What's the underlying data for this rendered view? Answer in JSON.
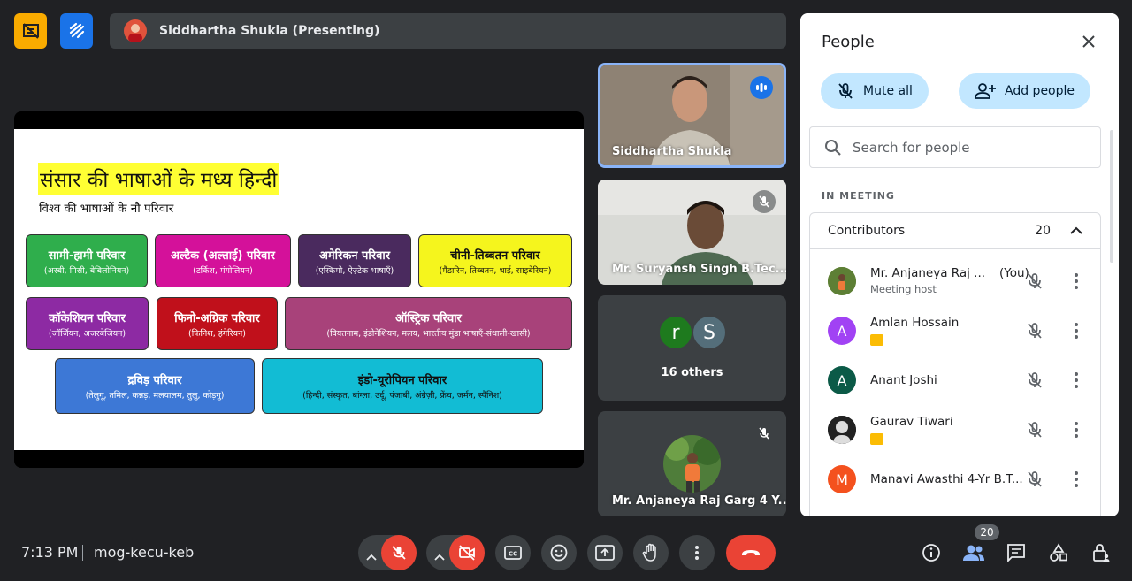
{
  "header": {
    "presenter_label": "Siddhartha Shukla (Presenting)"
  },
  "slide": {
    "title": "संसार की भाषाओं के मध्य हिन्दी",
    "subtitle": "विश्व की भाषाओं के नौ परिवार",
    "families": [
      {
        "name": "सामी-हामी परिवार",
        "desc": "(अरबी, मिस्री, बेबिलोनियन)",
        "bg": "#2fae4c",
        "fg": "#ffffff"
      },
      {
        "name": "अल्टैक (अल्ताई) परिवार",
        "desc": "(टर्किश, मंगोलियन)",
        "bg": "#d4119a",
        "fg": "#ffffff"
      },
      {
        "name": "अमेरिकन परिवार",
        "desc": "(एस्किमो, ऐज़्टेक भाषाएँ)",
        "bg": "#4a2a5e",
        "fg": "#ffffff"
      },
      {
        "name": "चीनी-तिब्बतन परिवार",
        "desc": "(मैंडारिन, तिब्बतन, थाई, साइबेरियन)",
        "bg": "#f5f51d",
        "fg": "#111111"
      },
      {
        "name": "कॉकेशियन परिवार",
        "desc": "(जॉर्जियन, अजरबेजियन)",
        "bg": "#8d2aa3",
        "fg": "#ffffff"
      },
      {
        "name": "फिनो-अग्रिक परिवार",
        "desc": "(फिनिश, हंगेरियन)",
        "bg": "#c0101b",
        "fg": "#ffffff"
      },
      {
        "name": "ऑस्ट्रिक परिवार",
        "desc": "(वियतनाम, इंडोनेशियन, मलय, भारतीय मुंडा भाषाएँ-संथाली-खासी)",
        "bg": "#a8427a",
        "fg": "#ffffff"
      },
      {
        "name": "द्रविड़ परिवार",
        "desc": "(तेलुगू, तमिल, कन्नड़, मलयालम, तुलु, कोड़गु)",
        "bg": "#3d78d6",
        "fg": "#ffffff"
      },
      {
        "name": "इंडो-यूरोपियन परिवार",
        "desc": "(हिन्दी, संस्कृत, बांग्ला, उर्दू, पंजाबी, अंग्रेज़ी, फ्रेंच, जर्मन, स्पैनिश)",
        "bg": "#12bcd4",
        "fg": "#111111"
      }
    ]
  },
  "tiles": {
    "speaker_name": "Siddhartha Shukla",
    "tile2_name": "Mr. Suryansh Singh B.Tec...",
    "others_initials": [
      "r",
      "S"
    ],
    "others_label": "16 others",
    "tile4_name": "Mr. Anjaneya Raj Garg 4 Y..."
  },
  "people_panel": {
    "title": "People",
    "mute_all": "Mute all",
    "add_people": "Add people",
    "search_placeholder": "Search for people",
    "section_label": "IN MEETING",
    "group_label": "Contributors",
    "group_count": "20",
    "participants": [
      {
        "name": "Mr. Anjaneya Raj ...",
        "you": "(You)",
        "sub": "Meeting host",
        "initial": "",
        "avatar_color": "#6b8f3a",
        "presenting": false
      },
      {
        "name": "Amlan Hossain",
        "you": "",
        "sub": "",
        "initial": "A",
        "avatar_color": "#a142f4",
        "presenting": true
      },
      {
        "name": "Anant Joshi",
        "you": "",
        "sub": "",
        "initial": "A",
        "avatar_color": "#0b5a47",
        "presenting": false
      },
      {
        "name": "Gaurav Tiwari",
        "you": "",
        "sub": "",
        "initial": "",
        "avatar_color": "#222222",
        "presenting": true
      },
      {
        "name": "Manavi Awasthi 4-Yr B.T...",
        "you": "",
        "sub": "",
        "initial": "M",
        "avatar_color": "#f4511e",
        "presenting": false
      }
    ]
  },
  "bottom_bar": {
    "time": "7:13 PM",
    "meeting_code": "mog-kecu-keb",
    "participant_badge": "20"
  }
}
